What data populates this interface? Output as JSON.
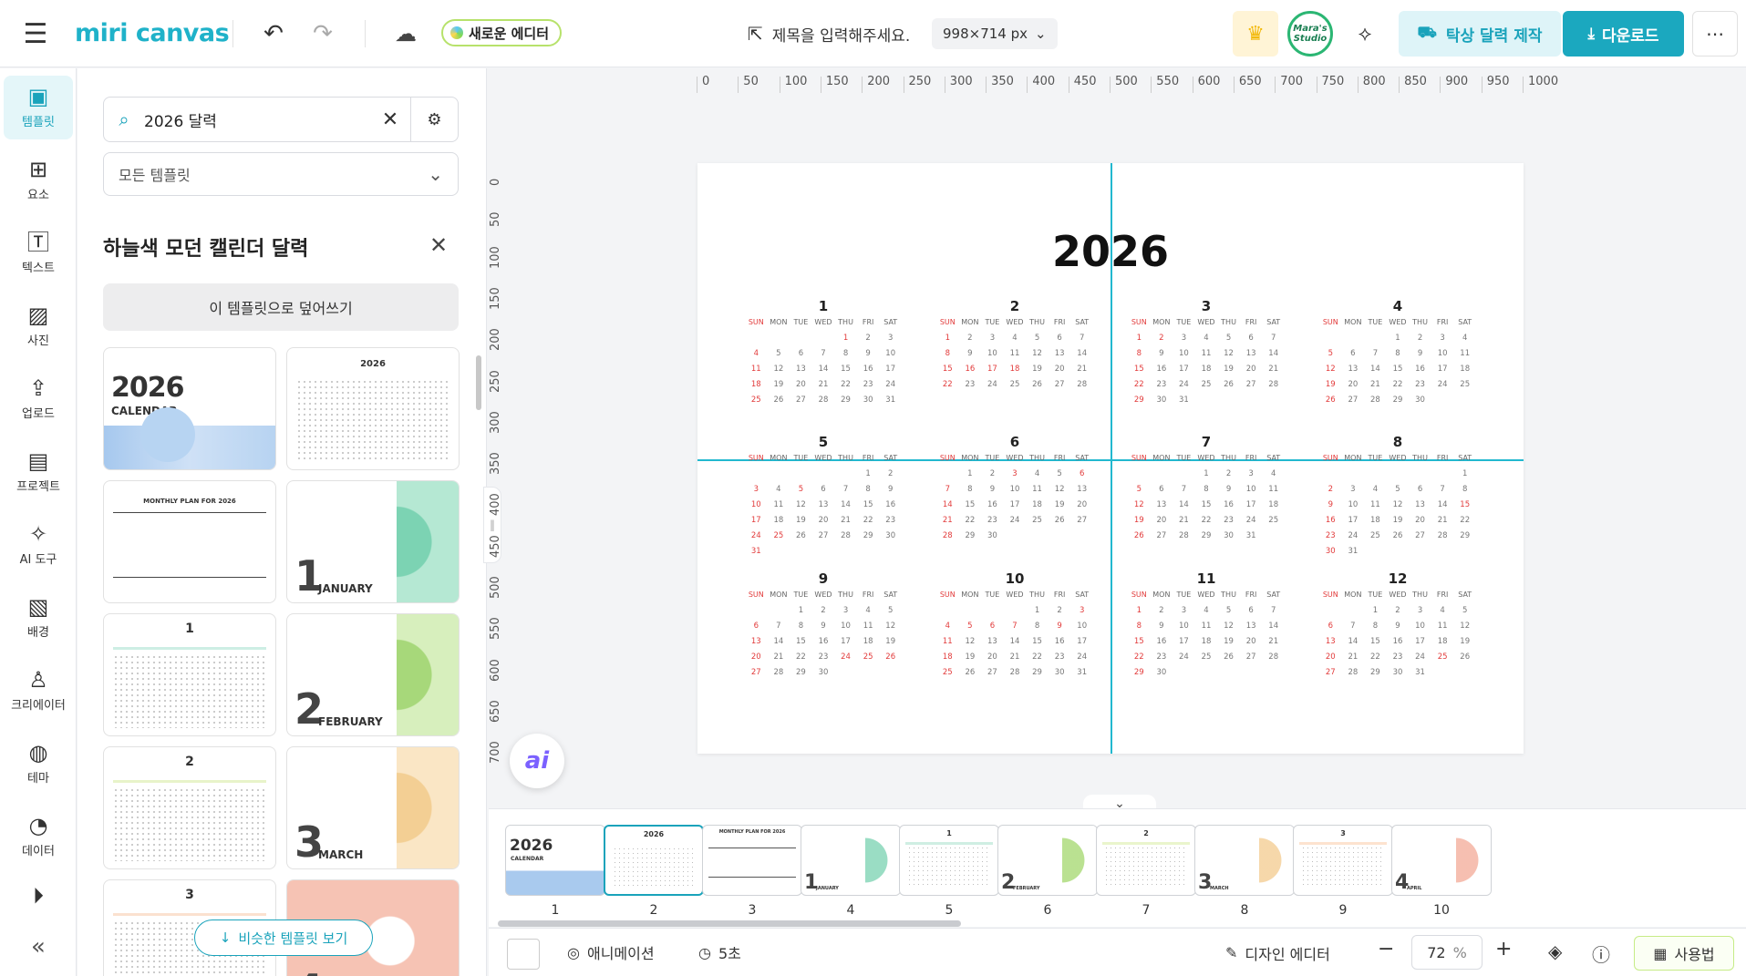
{
  "app": {
    "logo": "miri canvas",
    "new_editor_label": "새로운 에디터",
    "title_placeholder": "제목을 입력해주세요.",
    "size_label": "998×714 px",
    "avatar_text": "Mara's Studio",
    "desk_calendar_label": "탁상 달력 제작",
    "download_label": "다운로드"
  },
  "nav": {
    "items": [
      {
        "label": "템플릿",
        "icon": "template-icon"
      },
      {
        "label": "요소",
        "icon": "elements-icon"
      },
      {
        "label": "텍스트",
        "icon": "text-icon"
      },
      {
        "label": "사진",
        "icon": "photo-icon"
      },
      {
        "label": "업로드",
        "icon": "upload-icon"
      },
      {
        "label": "프로젝트",
        "icon": "project-icon"
      },
      {
        "label": "AI 도구",
        "icon": "ai-tools-icon"
      },
      {
        "label": "배경",
        "icon": "background-icon"
      },
      {
        "label": "크리에이터",
        "icon": "creator-icon"
      },
      {
        "label": "테마",
        "icon": "theme-icon"
      },
      {
        "label": "데이터",
        "icon": "data-icon"
      }
    ]
  },
  "panel": {
    "search_value": "2026 달력",
    "filter_value": "모든 템플릿",
    "template_title": "하늘색 모던 캘린더 달력",
    "overwrite_label": "이 템플릿으로 덮어쓰기",
    "similar_label": "비슷한 템플릿 보기",
    "thumbs": {
      "t1_year": "2026",
      "t1_sub": "CALENDAR",
      "t2_title": "2026",
      "t3_title": "MONTHLY PLAN FOR 2026",
      "t4_num": "1",
      "t4_month": "JANUARY",
      "t5_num": "1",
      "t6_num": "2",
      "t6_month": "FEBRUARY",
      "t7_num": "2",
      "t8_num": "3",
      "t8_month": "MARCH",
      "t9_num": "3",
      "t10_num": "4"
    }
  },
  "canvas": {
    "ruler_h": [
      "0",
      "50",
      "100",
      "150",
      "200",
      "250",
      "300",
      "350",
      "400",
      "450",
      "500",
      "550",
      "600",
      "650",
      "700",
      "750",
      "800",
      "850",
      "900",
      "950",
      "1000"
    ],
    "ruler_v": [
      "0",
      "50",
      "100",
      "150",
      "200",
      "250",
      "300",
      "350",
      "400",
      "450",
      "500",
      "550",
      "600",
      "650",
      "700"
    ],
    "year": "2026",
    "weekday_labels": [
      "SUN",
      "MON",
      "TUE",
      "WED",
      "THU",
      "FRI",
      "SAT"
    ],
    "months": [
      {
        "label": "1",
        "offset": 4,
        "days": 31,
        "red": [
          1
        ]
      },
      {
        "label": "2",
        "offset": 0,
        "days": 28,
        "red": [
          16,
          17,
          18
        ]
      },
      {
        "label": "3",
        "offset": 0,
        "days": 31,
        "red": [
          2
        ]
      },
      {
        "label": "4",
        "offset": 3,
        "days": 30,
        "red": []
      },
      {
        "label": "5",
        "offset": 5,
        "days": 31,
        "red": [
          5,
          25
        ]
      },
      {
        "label": "6",
        "offset": 1,
        "days": 30,
        "red": [
          3,
          6
        ]
      },
      {
        "label": "7",
        "offset": 3,
        "days": 31,
        "red": []
      },
      {
        "label": "8",
        "offset": 6,
        "days": 31,
        "red": [
          15
        ]
      },
      {
        "label": "9",
        "offset": 2,
        "days": 30,
        "red": [
          24,
          25,
          26
        ]
      },
      {
        "label": "10",
        "offset": 4,
        "days": 31,
        "red": [
          3,
          5,
          6,
          7,
          9
        ]
      },
      {
        "label": "11",
        "offset": 0,
        "days": 30,
        "red": []
      },
      {
        "label": "12",
        "offset": 2,
        "days": 31,
        "red": [
          25
        ]
      }
    ]
  },
  "filmstrip": {
    "slides": [
      "1",
      "2",
      "3",
      "4",
      "5",
      "6",
      "7",
      "8",
      "9",
      "10"
    ],
    "slide_texts": {
      "s1": "2026",
      "s1b": "CALENDAR",
      "s2": "2026",
      "s3": "MONTHLY PLAN FOR 2026",
      "s4": "1",
      "s4m": "JANUARY",
      "s5": "1",
      "s6": "2",
      "s6m": "FEBRUARY",
      "s7": "2",
      "s8": "3",
      "s8m": "MARCH",
      "s9": "3",
      "s10": "4",
      "s10m": "APRIL"
    }
  },
  "toolbar": {
    "animation_label": "애니메이션",
    "duration_label": "5초",
    "design_editor_label": "디자인 에디터",
    "zoom_value": "72",
    "zoom_unit": "%",
    "usage_label": "사용법"
  },
  "colors": {
    "brand": "#1ba8bf",
    "guide": "#22b8cf",
    "holiday_red": "#e23b3b"
  }
}
